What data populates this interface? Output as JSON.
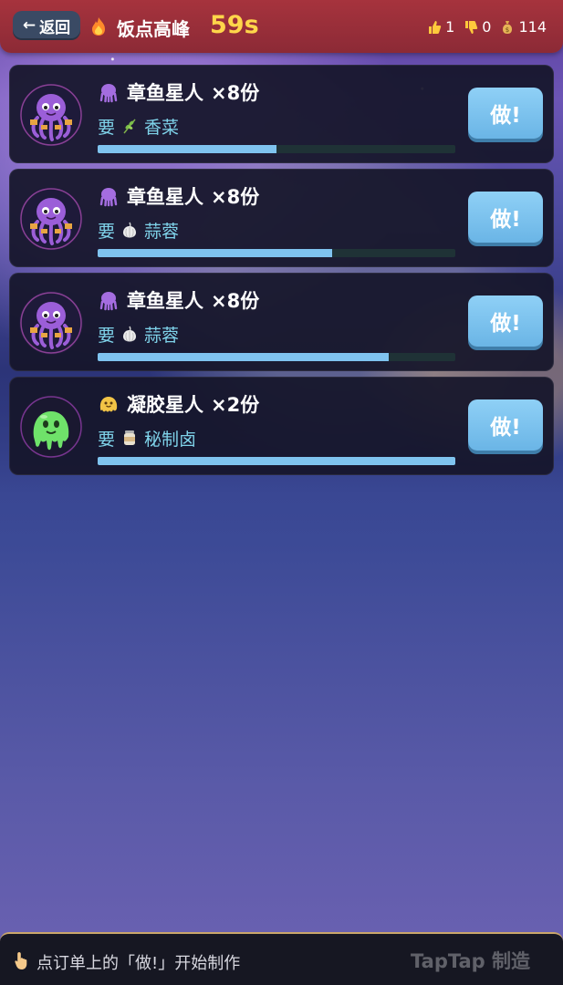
{
  "header": {
    "back_label": "返回",
    "back_arrow": "←",
    "fire_icon": "fire-icon",
    "stage_title": "饭点高峰",
    "timer": "59s",
    "likes": "1",
    "dislikes": "0",
    "coins": "114"
  },
  "orders": [
    {
      "customer": "章鱼星人",
      "quantity": "×8份",
      "need_label": "要",
      "ingredient": "香菜",
      "ingredient_icon": "herb-icon",
      "progress": 0.5,
      "button": "做!"
    },
    {
      "customer": "章鱼星人",
      "quantity": "×8份",
      "need_label": "要",
      "ingredient": "蒜蓉",
      "ingredient_icon": "garlic-icon",
      "progress": 0.655,
      "button": "做!"
    },
    {
      "customer": "章鱼星人",
      "quantity": "×8份",
      "need_label": "要",
      "ingredient": "蒜蓉",
      "ingredient_icon": "garlic-icon",
      "progress": 0.815,
      "button": "做!"
    },
    {
      "customer": "凝胶星人",
      "quantity": "×2份",
      "need_label": "要",
      "ingredient": "秘制卤",
      "ingredient_icon": "jar-icon",
      "progress": 1.0,
      "button": "做!"
    }
  ],
  "footer": {
    "hint": "点订单上的「做!」开始制作",
    "watermark": "TapTap 制造"
  },
  "colors": {
    "progress_fill": "#7fc3ef",
    "button": "#7ec6f2",
    "timer": "#ffd64a",
    "header": "#9a2f3a"
  }
}
